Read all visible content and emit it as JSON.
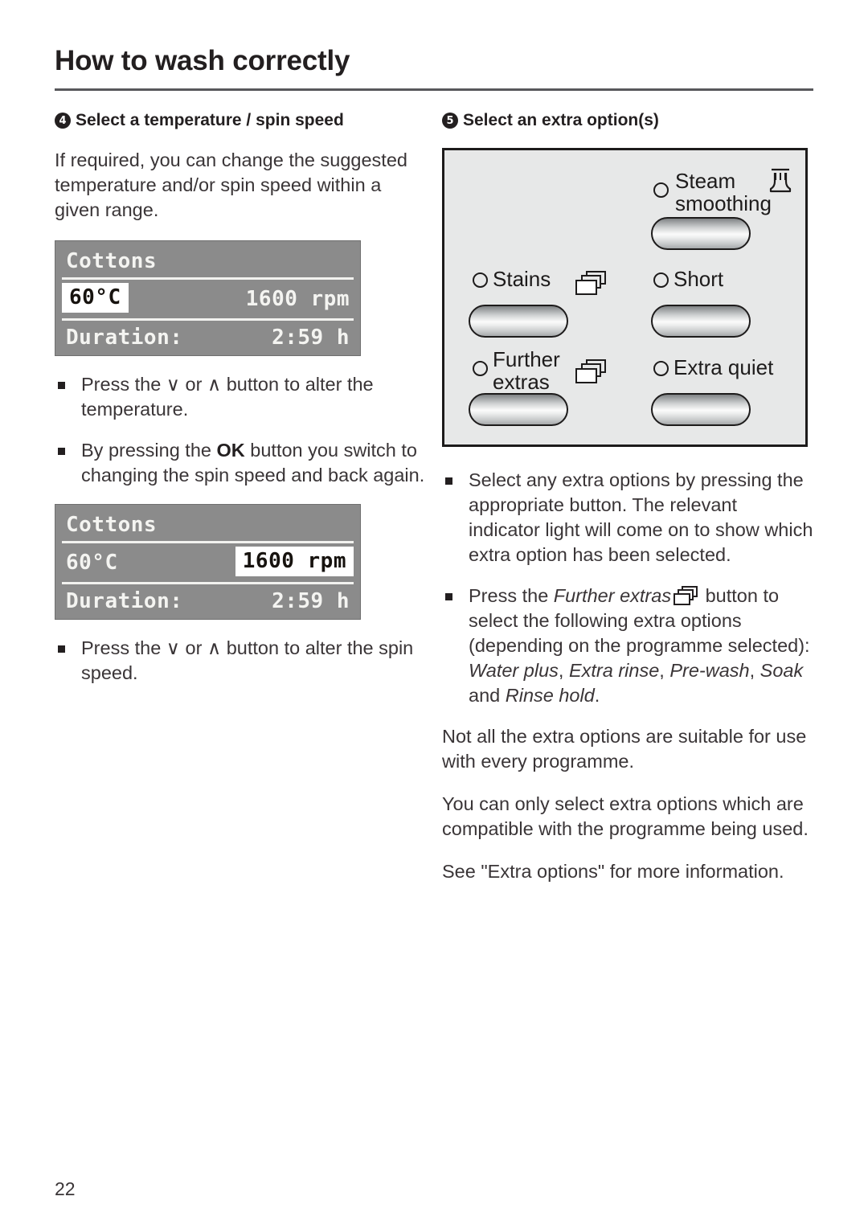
{
  "document": {
    "chapter_title": "How to wash correctly",
    "page_number": "22"
  },
  "left_column": {
    "step_number": "4",
    "heading": "Select a temperature / spin speed",
    "intro": "If required, you can change the suggested temperature and/or spin speed within a given range.",
    "display_1": {
      "programme": "Cottons",
      "temperature": "60°C",
      "spin_speed": "1600 rpm",
      "duration_label": "Duration:",
      "duration_value": "2:59 h",
      "highlighted_field": "temperature"
    },
    "bullet_1_pre": "Press the ",
    "bullet_1_down": "∨",
    "bullet_1_mid": " or ",
    "bullet_1_up": "∧",
    "bullet_1_post": " button to alter the temperature.",
    "bullet_2_pre": "By pressing the ",
    "bullet_2_strong": "OK",
    "bullet_2_post": " button you switch to changing the spin speed and back again.",
    "display_2": {
      "programme": "Cottons",
      "temperature": "60°C",
      "spin_speed": "1600 rpm",
      "duration_label": "Duration:",
      "duration_value": "2:59 h",
      "highlighted_field": "spin_speed"
    },
    "bullet_3_pre": "Press the ",
    "bullet_3_down": "∨",
    "bullet_3_mid": " or ",
    "bullet_3_up": "∧",
    "bullet_3_post": " button to alter the spin speed."
  },
  "right_column": {
    "step_number": "5",
    "heading": "Select an extra option(s)",
    "control_panel": {
      "options": [
        {
          "label": "Steam\nsmoothing",
          "icon": "steam-iron-icon",
          "led": "indicator-light",
          "button": "push-button"
        },
        {
          "label": "Stains",
          "icon": "further-extras-stack-icon",
          "led": "indicator-light",
          "button": "push-button"
        },
        {
          "label": "Short",
          "icon": "",
          "led": "indicator-light",
          "button": "push-button"
        },
        {
          "label": "Further\nextras",
          "icon": "further-extras-stack-icon",
          "led": "indicator-light",
          "button": "push-button"
        },
        {
          "label": "Extra quiet",
          "icon": "",
          "led": "indicator-light",
          "button": "push-button"
        }
      ]
    },
    "bullet_1": "Select any extra options by pressing the appropriate button.  The relevant indicator light will come on to show which extra option has been selected.",
    "bullet_2_pre": "Press the ",
    "bullet_2_ital": "Further extras",
    "bullet_2_mid": " button to select the following extra options (depending on the programme selected): ",
    "bullet_2_opt1": "Water plus",
    "bullet_2_sep1": ", ",
    "bullet_2_opt2": "Extra rinse",
    "bullet_2_sep2": ", ",
    "bullet_2_opt3": "Pre-wash",
    "bullet_2_sep3": ", ",
    "bullet_2_opt4": "Soak",
    "bullet_2_sep4": " and ",
    "bullet_2_opt5": "Rinse hold",
    "bullet_2_end": ".",
    "para_1": "Not all the extra options are suitable for use with every programme.",
    "para_2": "You can only select extra options which are compatible with the programme being used.",
    "para_3": "See \"Extra options\" for more information."
  },
  "colors": {
    "ink": "#231f20",
    "rule": "#58585b",
    "lcd_background": "#8b8b8b",
    "lcd_text": "#f4f4f1",
    "lcd_highlight_bg": "#ffffff",
    "panel_background": "#e7e8e8",
    "panel_border": "#1d1b1b"
  }
}
